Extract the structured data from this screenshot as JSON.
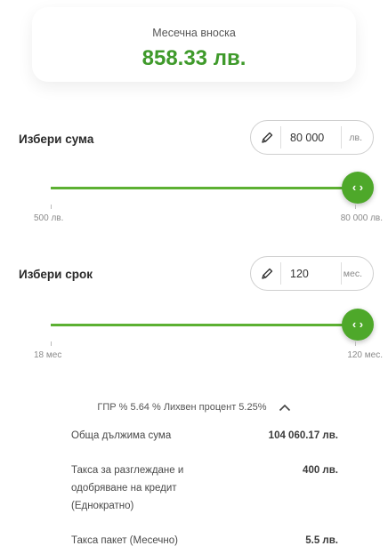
{
  "payment": {
    "label": "Месечна вноска",
    "value": "858.33 лв."
  },
  "amount": {
    "label": "Избери сума",
    "value": "80 000",
    "unit": "лв.",
    "min_label": "500 лв.",
    "max_label": "80 000 лв.",
    "position_fraction": 1.0,
    "knob_glyph": "‹ ›"
  },
  "term": {
    "label": "Избери срок",
    "value": "120",
    "unit": "мес.",
    "min_label": "18 мес",
    "max_label": "120 мес.",
    "position_fraction": 1.0,
    "knob_glyph": "‹ ›"
  },
  "summary": {
    "rates_text": "ГПР % 5.64 % Лихвен процент 5.25%"
  },
  "details": [
    {
      "label": "Обща дължима сума",
      "value": "104 060.17 лв."
    },
    {
      "label": "Такса за разглеждане и одобряване на кредит (Еднократно)",
      "value": "400 лв."
    },
    {
      "label": "Такса пакет (Месечно)",
      "value": "5.5 лв."
    }
  ],
  "colors": {
    "accent": "#4ea82a",
    "accent_text": "#3f9a2b"
  },
  "icons": {
    "edit": "pencil-icon",
    "slider_handle": "chevrons-left-right-icon",
    "toggle": "chevron-up-icon"
  }
}
